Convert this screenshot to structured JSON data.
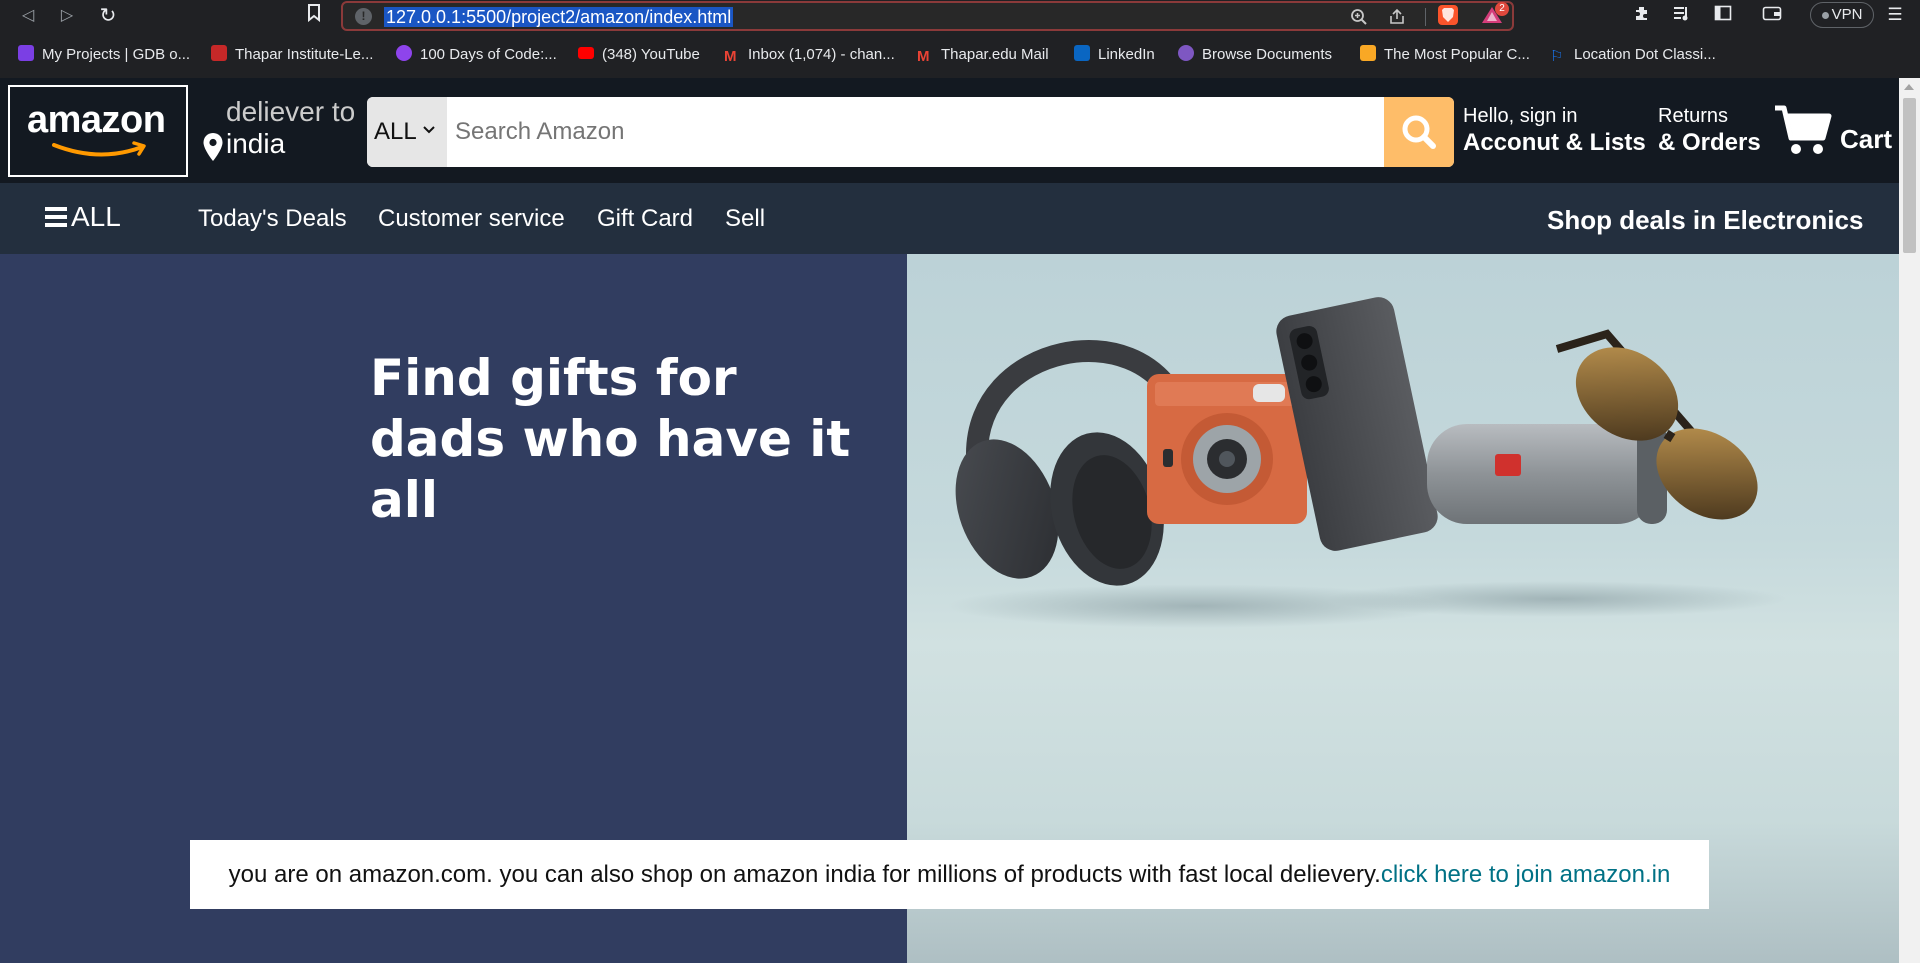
{
  "browser": {
    "url": "127.0.0.1:5500/project2/amazon/index.html",
    "reward_count": "2",
    "vpn_label": "VPN",
    "bookmarks": [
      {
        "label": "My Projects | GDB o...",
        "color": "#7b3fe4"
      },
      {
        "label": "Thapar Institute-Le...",
        "color": "#c62828"
      },
      {
        "label": "100 Days of Code:...",
        "color": "#8e44ec"
      },
      {
        "label": "(348) YouTube",
        "color": "#ff0000"
      },
      {
        "label": "Inbox (1,074) - chan...",
        "color": "#ea4335"
      },
      {
        "label": "Thapar.edu Mail",
        "color": "#ea4335"
      },
      {
        "label": "LinkedIn",
        "color": "#0a66c2"
      },
      {
        "label": "Browse Documents",
        "color": "#7e57c2"
      },
      {
        "label": "The Most Popular C...",
        "color": "#f9a825"
      },
      {
        "label": "Location Dot Classi...",
        "color": "#1a73e8"
      }
    ]
  },
  "header": {
    "logo_text": "amazon",
    "deliver_line1": "deliever to",
    "deliver_line2": "india",
    "search_category": "ALL",
    "search_placeholder": "Search Amazon",
    "account_line1": "Hello, sign in",
    "account_line2": "Acconut & Lists",
    "returns_line1": "Returns",
    "returns_line2": "& Orders",
    "cart_label": "Cart"
  },
  "subnav": {
    "all_label": "ALL",
    "links": [
      "Today's Deals",
      "Customer service",
      "Gift Card",
      "Sell"
    ],
    "deals_label": "Shop deals in Electronics"
  },
  "hero": {
    "title_line1": "Find gifts for",
    "title_line2": "dads who have it all",
    "left_bg": "#313d60"
  },
  "promo": {
    "text": "you are on amazon.com. you can also shop on amazon india for millions of products with fast local delievery.",
    "link": "click here to join amazon.in"
  },
  "colors": {
    "header_bg": "#131921",
    "subnav_bg": "#232f3e",
    "search_button": "#febd69",
    "link": "#007185"
  }
}
